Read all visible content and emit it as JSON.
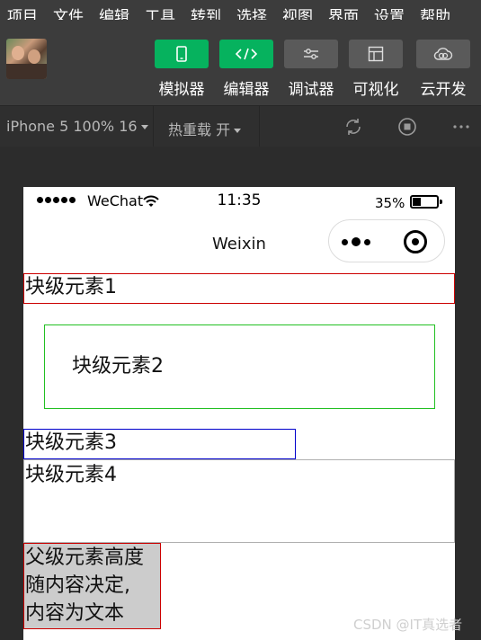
{
  "menubar": {
    "items": [
      "项目",
      "文件",
      "编辑",
      "工具",
      "转到",
      "选择",
      "视图",
      "界面",
      "设置",
      "帮助"
    ]
  },
  "toolbar": {
    "buttons": [
      {
        "label": "模拟器",
        "icon": "phone-icon",
        "style": "green"
      },
      {
        "label": "编辑器",
        "icon": "code-icon",
        "style": "green"
      },
      {
        "label": "调试器",
        "icon": "sliders-icon",
        "style": "gray"
      },
      {
        "label": "可视化",
        "icon": "layout-icon",
        "style": "gray"
      },
      {
        "label": "云开发",
        "icon": "cloud-icon",
        "style": "gray"
      }
    ]
  },
  "subbar": {
    "device": "iPhone 5 100% 16",
    "hot_reload": "热重载 开",
    "icons": [
      "refresh-icon",
      "stop-icon",
      "more-icon"
    ]
  },
  "phone": {
    "carrier": "WeChat",
    "time": "11:35",
    "battery": "35%",
    "battery_level": 0.35,
    "nav_title": "Weixin"
  },
  "blocks": {
    "b1": "块级元素1",
    "b2": "块级元素2",
    "b3": "块级元素3",
    "b4": "块级元素4",
    "b5_lines": [
      "父级元素高度",
      "随内容决定,",
      "内容为文本"
    ]
  },
  "watermark": "CSDN @IT真选者",
  "colors": {
    "accent_green": "#06b25e",
    "toolbar_bg": "#3c3c3c",
    "block1_border": "#cc0000",
    "block2_border": "#22c022",
    "block3_border": "#0000cc"
  }
}
